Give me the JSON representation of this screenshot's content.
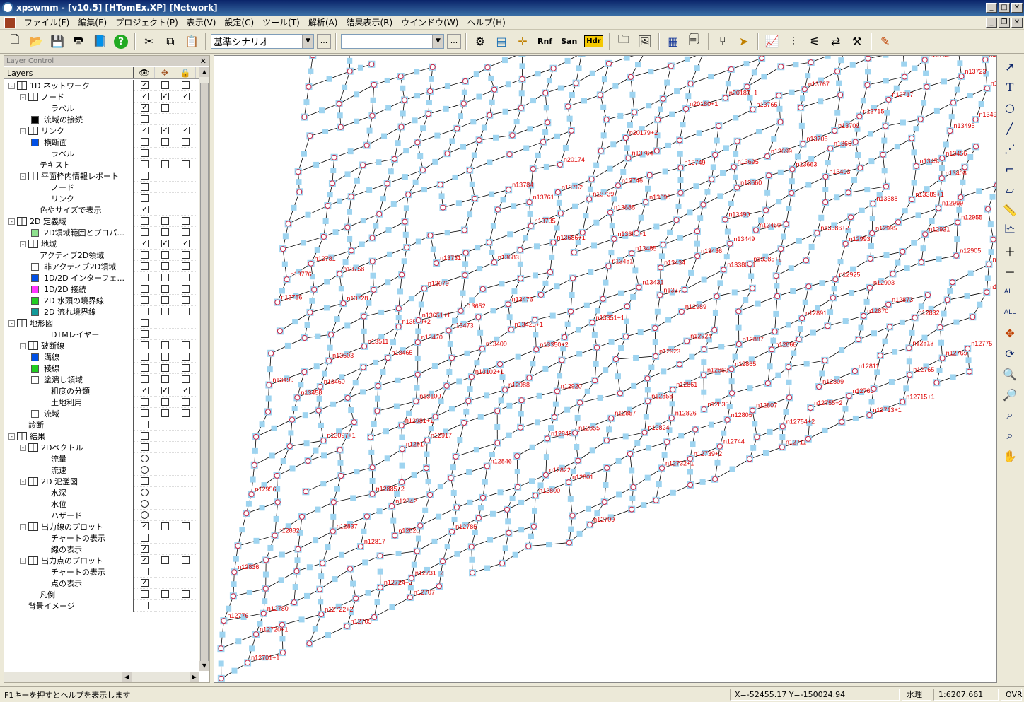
{
  "window": {
    "title": "xpswmm - [v10.5] [HTomEx.XP] [Network]"
  },
  "menu": [
    "ファイル(F)",
    "編集(E)",
    "プロジェクト(P)",
    "表示(V)",
    "設定(C)",
    "ツール(T)",
    "解析(A)",
    "結果表示(R)",
    "ウインドウ(W)",
    "ヘルプ(H)"
  ],
  "toolbar": {
    "scenario": "基準シナリオ",
    "more": "...",
    "second_combo": "",
    "rnf": "Rnf",
    "san": "San",
    "hdr": "Hdr"
  },
  "layer_panel": {
    "title": "Layer Control",
    "header": "Layers",
    "rows": [
      {
        "label": "1D ネットワーク",
        "indent": 0,
        "exp": "-",
        "icon": "book",
        "checks": [
          "c",
          "e",
          "e"
        ]
      },
      {
        "label": "ノード",
        "indent": 1,
        "exp": "-",
        "icon": "book",
        "checks": [
          "c",
          "c",
          "c"
        ]
      },
      {
        "label": "ラベル",
        "indent": 3,
        "icon": "none",
        "checks": [
          "c",
          "e",
          ""
        ]
      },
      {
        "label": "流域の接続",
        "indent": 2,
        "icon": "swatch",
        "color": "#000000",
        "checks": [
          "e",
          "",
          ""
        ]
      },
      {
        "label": "リンク",
        "indent": 1,
        "exp": "-",
        "icon": "book",
        "checks": [
          "c",
          "c",
          "c"
        ]
      },
      {
        "label": "横断面",
        "indent": 2,
        "icon": "swatch",
        "color": "#0050e6",
        "checks": [
          "e",
          "e",
          "e"
        ]
      },
      {
        "label": "ラベル",
        "indent": 3,
        "icon": "none",
        "checks": [
          "e",
          "",
          ""
        ]
      },
      {
        "label": "テキスト",
        "indent": 2,
        "icon": "none",
        "checks": [
          "e",
          "e",
          "e"
        ]
      },
      {
        "label": "平面枠内情報レポート",
        "indent": 1,
        "exp": "-",
        "icon": "book",
        "checks": [
          "e",
          "",
          ""
        ]
      },
      {
        "label": "ノード",
        "indent": 3,
        "icon": "none",
        "checks": [
          "e",
          "",
          ""
        ]
      },
      {
        "label": "リンク",
        "indent": 3,
        "icon": "none",
        "checks": [
          "e",
          "",
          ""
        ]
      },
      {
        "label": "色やサイズで表示",
        "indent": 2,
        "icon": "none",
        "checks": [
          "c",
          "",
          ""
        ]
      },
      {
        "label": "2D 定義域",
        "indent": 0,
        "exp": "-",
        "icon": "book",
        "checks": [
          "e",
          "e",
          "e"
        ]
      },
      {
        "label": "2D領域範囲とプロパ...",
        "indent": 2,
        "icon": "swatch",
        "color": "#8ee08e",
        "checks": [
          "e",
          "e",
          "e"
        ]
      },
      {
        "label": "地域",
        "indent": 1,
        "exp": "-",
        "icon": "book",
        "checks": [
          "c",
          "c",
          "c"
        ]
      },
      {
        "label": "アクティブ2D領域",
        "indent": 2,
        "icon": "none",
        "checks": [
          "e",
          "e",
          "e"
        ]
      },
      {
        "label": "非アクティブ2D領域",
        "indent": 2,
        "icon": "swatch",
        "color": "#ffffff",
        "checks": [
          "e",
          "e",
          "e"
        ]
      },
      {
        "label": "1D/2D インターフェ...",
        "indent": 2,
        "icon": "swatch",
        "color": "#0050e6",
        "checks": [
          "e",
          "e",
          "e"
        ]
      },
      {
        "label": "1D/2D 接続",
        "indent": 2,
        "icon": "swatch",
        "color": "#ff33ff",
        "checks": [
          "e",
          "e",
          "e"
        ]
      },
      {
        "label": "2D 水頭の境界線",
        "indent": 2,
        "icon": "swatch",
        "color": "#22cc22",
        "checks": [
          "e",
          "e",
          "e"
        ]
      },
      {
        "label": "2D 流れ境界線",
        "indent": 2,
        "icon": "swatch",
        "color": "#119999",
        "checks": [
          "e",
          "e",
          "e"
        ]
      },
      {
        "label": "地形図",
        "indent": 0,
        "exp": "-",
        "icon": "book",
        "checks": [
          "e",
          "",
          ""
        ]
      },
      {
        "label": "DTMレイヤー",
        "indent": 3,
        "icon": "none",
        "checks": [
          "e",
          "",
          ""
        ]
      },
      {
        "label": "破断線",
        "indent": 1,
        "exp": "-",
        "icon": "book",
        "checks": [
          "e",
          "e",
          "e"
        ]
      },
      {
        "label": "溝線",
        "indent": 2,
        "icon": "swatch",
        "color": "#0050e6",
        "checks": [
          "e",
          "e",
          "e"
        ]
      },
      {
        "label": "稜線",
        "indent": 2,
        "icon": "swatch",
        "color": "#22cc22",
        "checks": [
          "e",
          "e",
          "e"
        ]
      },
      {
        "label": "塗潰し領域",
        "indent": 2,
        "icon": "swatch",
        "color": "#ffffff",
        "checks": [
          "e",
          "e",
          "e"
        ]
      },
      {
        "label": "粗度の分類",
        "indent": 3,
        "icon": "none",
        "checks": [
          "c",
          "c",
          "c"
        ]
      },
      {
        "label": "土地利用",
        "indent": 3,
        "icon": "none",
        "checks": [
          "e",
          "e",
          "e"
        ]
      },
      {
        "label": "流域",
        "indent": 2,
        "icon": "swatch",
        "color": "#ffffff",
        "checks": [
          "e",
          "e",
          "e"
        ]
      },
      {
        "label": "診断",
        "indent": 1,
        "icon": "none",
        "checks": [
          "e",
          "",
          ""
        ]
      },
      {
        "label": "結果",
        "indent": 0,
        "exp": "-",
        "icon": "book",
        "checks": [
          "e",
          "",
          ""
        ]
      },
      {
        "label": "2Dベクトル",
        "indent": 1,
        "exp": "-",
        "icon": "book",
        "checks": [
          "e",
          "",
          ""
        ]
      },
      {
        "label": "流量",
        "indent": 3,
        "icon": "none",
        "checks": [
          "r",
          "",
          ""
        ]
      },
      {
        "label": "流速",
        "indent": 3,
        "icon": "none",
        "checks": [
          "r",
          "",
          ""
        ]
      },
      {
        "label": "2D 氾濫図",
        "indent": 1,
        "exp": "-",
        "icon": "book",
        "checks": [
          "e",
          "",
          ""
        ]
      },
      {
        "label": "水深",
        "indent": 3,
        "icon": "none",
        "checks": [
          "r",
          "",
          ""
        ]
      },
      {
        "label": "水位",
        "indent": 3,
        "icon": "none",
        "checks": [
          "r",
          "",
          ""
        ]
      },
      {
        "label": "ハザード",
        "indent": 3,
        "icon": "none",
        "checks": [
          "r",
          "",
          ""
        ]
      },
      {
        "label": "出力線のプロット",
        "indent": 1,
        "exp": "-",
        "icon": "book",
        "checks": [
          "c",
          "e",
          "e"
        ]
      },
      {
        "label": "チャートの表示",
        "indent": 3,
        "icon": "none",
        "checks": [
          "e",
          "",
          ""
        ]
      },
      {
        "label": "線の表示",
        "indent": 3,
        "icon": "none",
        "checks": [
          "c",
          "",
          ""
        ]
      },
      {
        "label": "出力点のプロット",
        "indent": 1,
        "exp": "-",
        "icon": "book",
        "checks": [
          "c",
          "e",
          "e"
        ]
      },
      {
        "label": "チャートの表示",
        "indent": 3,
        "icon": "none",
        "checks": [
          "e",
          "",
          ""
        ]
      },
      {
        "label": "点の表示",
        "indent": 3,
        "icon": "none",
        "checks": [
          "c",
          "",
          ""
        ]
      },
      {
        "label": "凡例",
        "indent": 2,
        "icon": "none",
        "checks": [
          "e",
          "e",
          "e"
        ]
      },
      {
        "label": "背景イメージ",
        "indent": 1,
        "icon": "none",
        "checks": [
          "e",
          "",
          ""
        ]
      }
    ]
  },
  "map": {
    "node_labels": [
      "n12701+1",
      "n12705",
      "n12707",
      "n12709",
      "n12711",
      "n12713+1",
      "n12715+1",
      "n12720+1",
      "n12722+2",
      "n12724+2",
      "n12731+2",
      "n12732+1",
      "n12739+2",
      "n12744",
      "n12754+2",
      "n12755+2",
      "n12763",
      "n12765",
      "n12769",
      "n12775",
      "n12776",
      "n12780",
      "n12785",
      "n12800",
      "n12801",
      "n12805",
      "n12807",
      "n12809",
      "n12811",
      "n12813",
      "n12817",
      "n12820",
      "n12822",
      "n12824",
      "n12826",
      "n12830",
      "n12832",
      "n12835",
      "n12836",
      "n12837",
      "n12842",
      "n12846",
      "n12848",
      "n12855",
      "n12857",
      "n12858",
      "n12861",
      "n12863",
      "n12865",
      "n12868",
      "n12870",
      "n12873",
      "n12877",
      "n12882",
      "n12885+2",
      "n12887",
      "n12891",
      "n12903",
      "n12905",
      "n12914",
      "n12917",
      "n12920",
      "n12923",
      "n12924",
      "n12925",
      "n12931",
      "n12955",
      "n12956",
      "n12981+1",
      "n12988",
      "n12989",
      "n12993",
      "n12995",
      "n12999",
      "n13000",
      "n13097+1",
      "n13100",
      "n13102+1",
      "n13350+2",
      "n13351+1",
      "n13378",
      "n13380+1",
      "n13385+2",
      "n13386+2",
      "n13388",
      "n13389+1",
      "n13408",
      "n13409",
      "n13425+1",
      "n13431",
      "n13434",
      "n13436",
      "n13449",
      "n13450",
      "n13452",
      "n13456",
      "n13458",
      "n13460",
      "n13465",
      "n13470",
      "n13473",
      "n13476",
      "n13481",
      "n13485",
      "n13490",
      "n13493",
      "n13495",
      "n13497",
      "n13499",
      "n13503",
      "n13511",
      "n13559+2",
      "n13651+1",
      "n13652",
      "n13655+1",
      "n13660",
      "n13663",
      "n13669",
      "n13673",
      "n13679",
      "n13683",
      "n13686+1",
      "n13688",
      "n13690",
      "n13695",
      "n13699",
      "n13705",
      "n13709",
      "n13715",
      "n13717",
      "n13723",
      "n13726",
      "n13728",
      "n13731",
      "n13735",
      "n13739",
      "n13746",
      "n13749",
      "n13752",
      "n13756",
      "n13758",
      "n13761",
      "n13762",
      "n13764",
      "n13765",
      "n13767",
      "n13768",
      "n13771",
      "n13776",
      "n13781",
      "n13784",
      "n20174",
      "n20179+2",
      "n20180+1",
      "n20187+1"
    ],
    "scenario_note": ""
  },
  "status": {
    "message": "F1キーを押すとヘルプを表示します",
    "coords": "X=-52455.17   Y=-150024.94",
    "mode": "水理",
    "scale": "1:6207.661",
    "ovr": "OVR"
  }
}
